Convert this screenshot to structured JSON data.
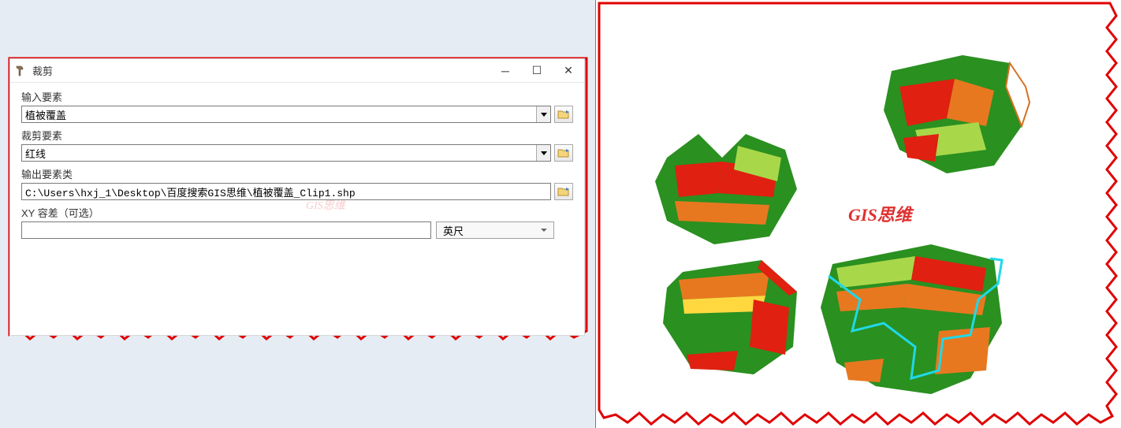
{
  "dialog": {
    "title": "裁剪",
    "fields": {
      "input_features": {
        "label": "输入要素",
        "value": "植被覆盖"
      },
      "clip_features": {
        "label": "裁剪要素",
        "value": "红线"
      },
      "output_class": {
        "label": "输出要素类",
        "value": "C:\\Users\\hxj_1\\Desktop\\百度搜索GIS思维\\植被覆盖_Clip1.shp"
      },
      "tolerance": {
        "label": "XY 容差（可选）",
        "value": "",
        "unit": "英尺"
      }
    }
  },
  "watermark": "GIS思维"
}
